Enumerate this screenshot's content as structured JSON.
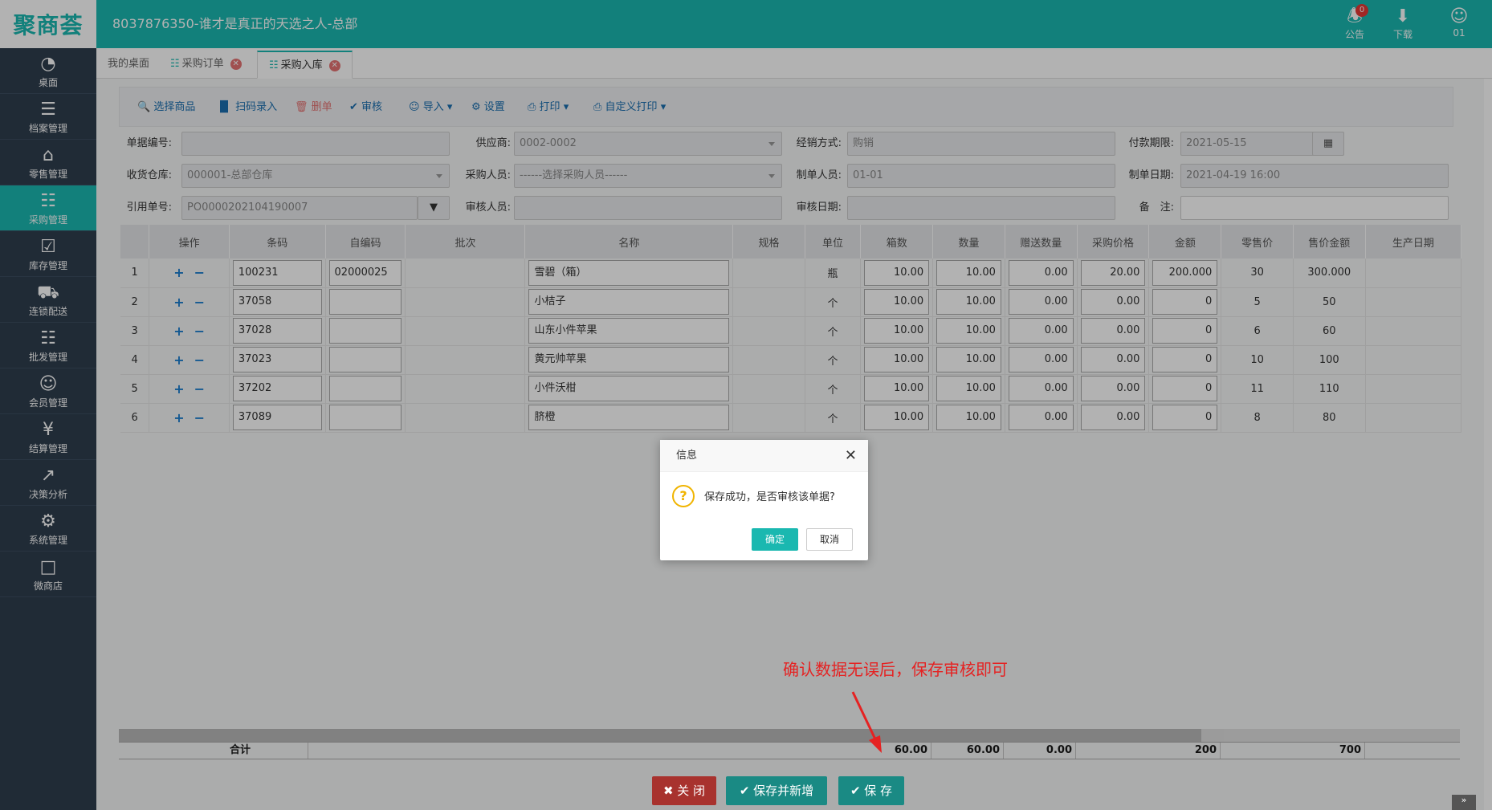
{
  "app": {
    "logo": "聚商荟",
    "title": "8037876350-谁才是真正的天选之人-总部",
    "notice_label": "公告",
    "notice_count": "0",
    "download_label": "下载",
    "user_label": "01"
  },
  "sidebar": {
    "items": [
      {
        "label": "桌面",
        "icon": "dashboard-icon"
      },
      {
        "label": "档案管理",
        "icon": "archive-icon"
      },
      {
        "label": "零售管理",
        "icon": "store-icon"
      },
      {
        "label": "采购管理",
        "icon": "cart-icon"
      },
      {
        "label": "库存管理",
        "icon": "inventory-icon"
      },
      {
        "label": "连锁配送",
        "icon": "truck-icon"
      },
      {
        "label": "批发管理",
        "icon": "wholesale-icon"
      },
      {
        "label": "会员管理",
        "icon": "member-icon"
      },
      {
        "label": "结算管理",
        "icon": "settlement-icon"
      },
      {
        "label": "决策分析",
        "icon": "chart-icon"
      },
      {
        "label": "系统管理",
        "icon": "gear-icon"
      },
      {
        "label": "微商店",
        "icon": "shop-icon"
      }
    ]
  },
  "tabs": [
    {
      "label": "我的桌面"
    },
    {
      "label": "采购订单"
    },
    {
      "label": "采购入库"
    }
  ],
  "toolbar": {
    "select_goods": "选择商品",
    "scan_entry": "扫码录入",
    "delete_row": "删单",
    "audit": "审核",
    "import": "导入",
    "settings": "设置",
    "print": "打印",
    "custom_print": "自定义打印"
  },
  "form": {
    "doc_no_label": "单据编号:",
    "doc_no_value": "",
    "supplier_label": "供应商:",
    "supplier_value": "0002-0002",
    "sales_mode_label": "经销方式:",
    "sales_mode_value": "购销",
    "pay_due_label": "付款期限:",
    "pay_due_value": "2021-05-15",
    "warehouse_label": "收货仓库:",
    "warehouse_value": "000001-总部仓库",
    "buyer_label": "采购人员:",
    "buyer_placeholder": "------选择采购人员------",
    "maker_label": "制单人员:",
    "maker_value": "01-01",
    "make_date_label": "制单日期:",
    "make_date_value": "2021-04-19 16:00",
    "ref_no_label": "引用单号:",
    "ref_no_value": "PO0000202104190007",
    "auditor_label": "审核人员:",
    "auditor_value": "",
    "audit_date_label": "审核日期:",
    "audit_date_value": "",
    "remark_label": "备　注:",
    "remark_value": ""
  },
  "grid": {
    "headers": [
      "",
      "操作",
      "条码",
      "自编码",
      "批次",
      "名称",
      "规格",
      "单位",
      "箱数",
      "数量",
      "赠送数量",
      "采购价格",
      "金额",
      "零售价",
      "售价金额",
      "生产日期"
    ],
    "rows": [
      {
        "no": "1",
        "barcode": "100231",
        "selfcode": "02000025",
        "batch": "",
        "name": "雪碧（箱）",
        "spec": "",
        "unit": "瓶",
        "boxes": "10.00",
        "qty": "10.00",
        "gift": "0.00",
        "price": "20.00",
        "amount": "200.000",
        "retail": "30",
        "sale_amount": "300.000"
      },
      {
        "no": "2",
        "barcode": "37058",
        "selfcode": "",
        "batch": "",
        "name": "小桔子",
        "spec": "",
        "unit": "个",
        "boxes": "10.00",
        "qty": "10.00",
        "gift": "0.00",
        "price": "0.00",
        "amount": "0",
        "retail": "5",
        "sale_amount": "50"
      },
      {
        "no": "3",
        "barcode": "37028",
        "selfcode": "",
        "batch": "",
        "name": "山东小件苹果",
        "spec": "",
        "unit": "个",
        "boxes": "10.00",
        "qty": "10.00",
        "gift": "0.00",
        "price": "0.00",
        "amount": "0",
        "retail": "6",
        "sale_amount": "60"
      },
      {
        "no": "4",
        "barcode": "37023",
        "selfcode": "",
        "batch": "",
        "name": "黄元帅苹果",
        "spec": "",
        "unit": "个",
        "boxes": "10.00",
        "qty": "10.00",
        "gift": "0.00",
        "price": "0.00",
        "amount": "0",
        "retail": "10",
        "sale_amount": "100"
      },
      {
        "no": "5",
        "barcode": "37202",
        "selfcode": "",
        "batch": "",
        "name": "小件沃柑",
        "spec": "",
        "unit": "个",
        "boxes": "10.00",
        "qty": "10.00",
        "gift": "0.00",
        "price": "0.00",
        "amount": "0",
        "retail": "11",
        "sale_amount": "110"
      },
      {
        "no": "6",
        "barcode": "37089",
        "selfcode": "",
        "batch": "",
        "name": "脐橙",
        "spec": "",
        "unit": "个",
        "boxes": "10.00",
        "qty": "10.00",
        "gift": "0.00",
        "price": "0.00",
        "amount": "0",
        "retail": "8",
        "sale_amount": "80"
      }
    ],
    "total_label": "合计",
    "total_boxes": "60.00",
    "total_qty": "60.00",
    "total_gift": "0.00",
    "total_amount": "200",
    "total_sale_amount": "700"
  },
  "buttons": {
    "close": "关 闭",
    "save_and_new": "保存并新增",
    "save": "保 存"
  },
  "dialog": {
    "title": "信息",
    "message": "保存成功，是否审核该单据?",
    "confirm": "确定",
    "cancel": "取消"
  },
  "annotation": "确认数据无误后，保存审核即可",
  "colors": {
    "brand": "#1ab8b0",
    "sidebar": "#2f3e4e",
    "close_button": "#c9302c",
    "annotation": "#e52222"
  }
}
